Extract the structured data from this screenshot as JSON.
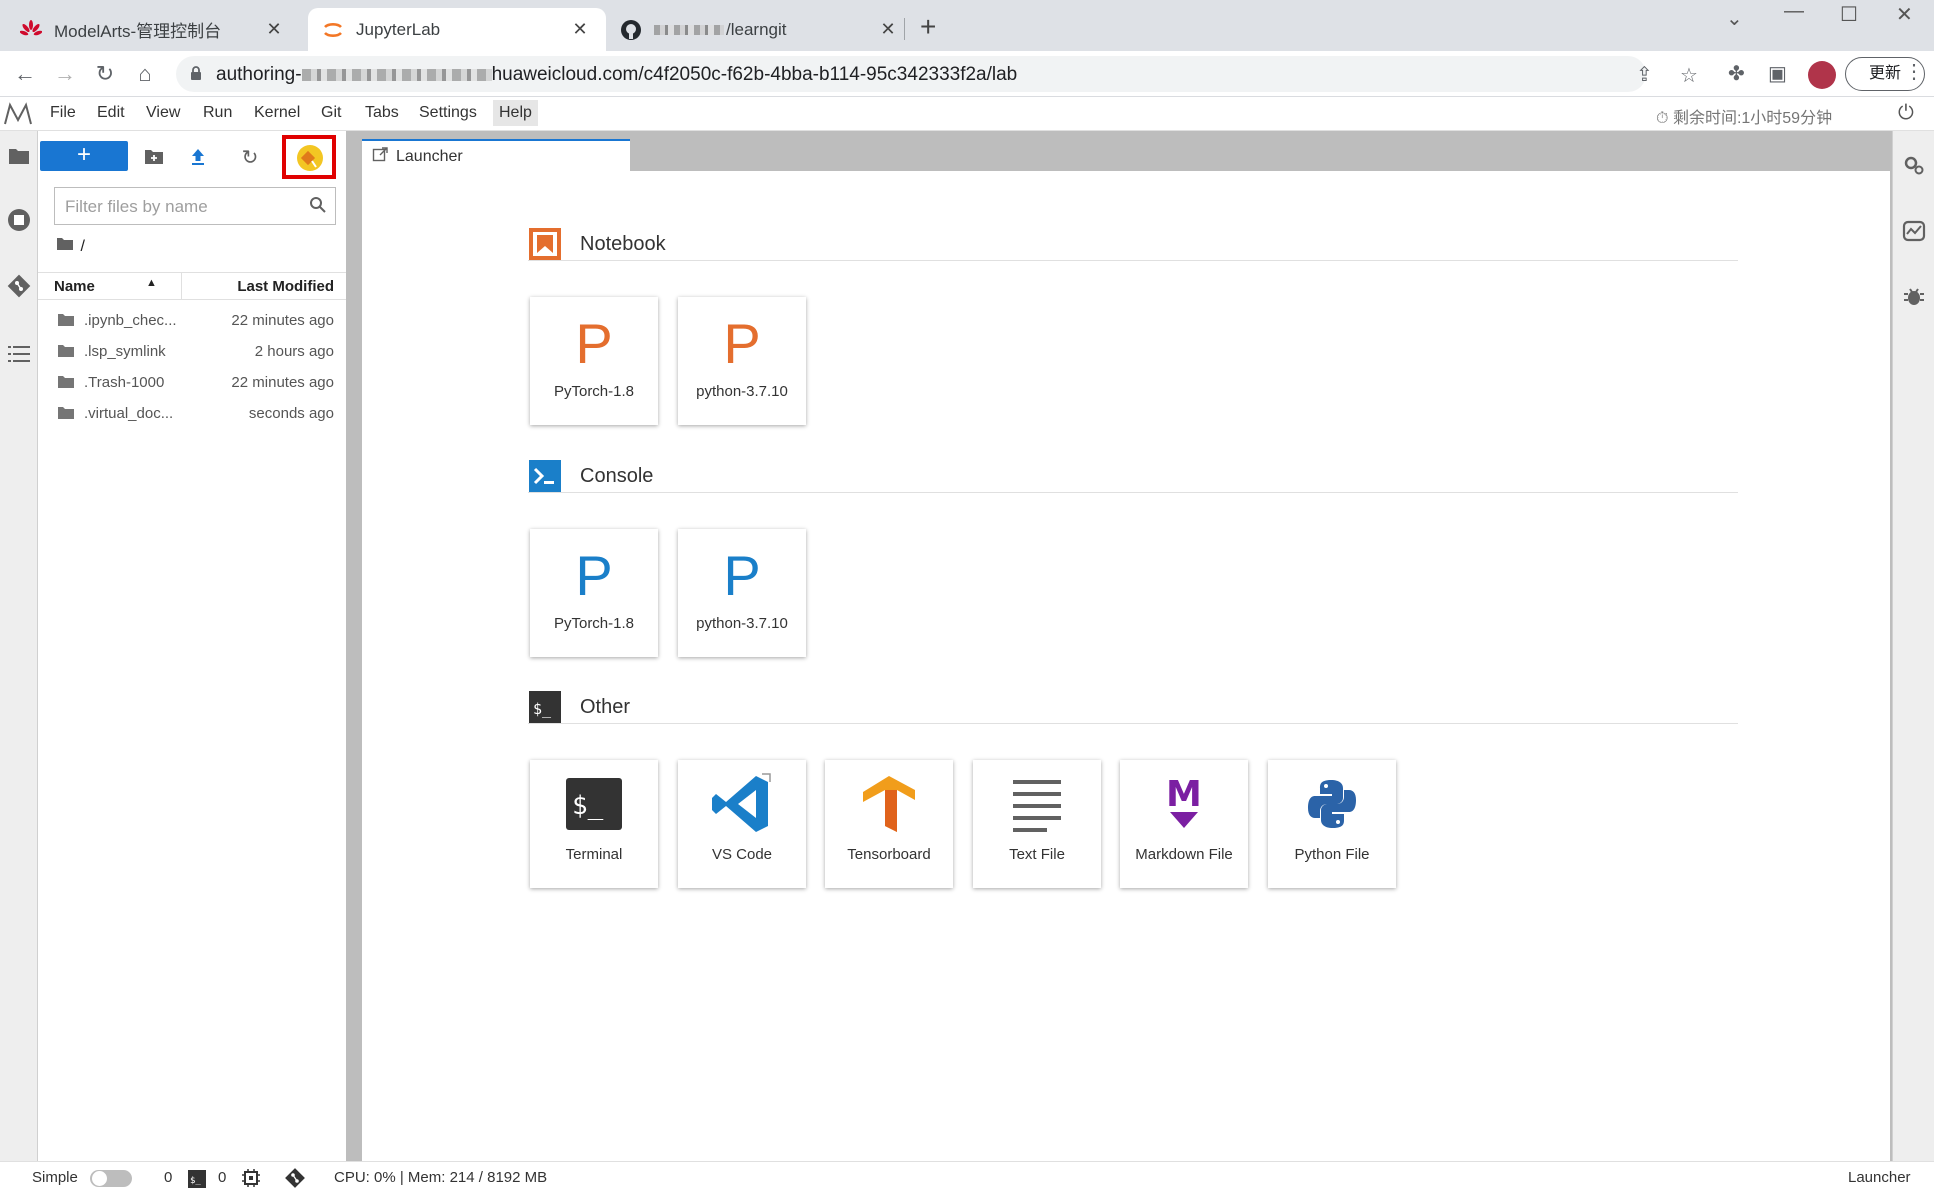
{
  "browser": {
    "tabs": [
      {
        "title": "ModelArts-管理控制台",
        "icon": "huawei-logo-icon"
      },
      {
        "title": "JupyterLab",
        "icon": "jupyter-logo-icon"
      },
      {
        "title": "/learngit",
        "icon": "github-logo-icon"
      }
    ],
    "url_prefix": "authoring-",
    "url_suffix": "huaweicloud.com/c4f2050c-f62b-4bba-b114-95c342333f2a/lab",
    "update_label": "更新"
  },
  "menubar": {
    "items": [
      "File",
      "Edit",
      "View",
      "Run",
      "Kernel",
      "Git",
      "Tabs",
      "Settings",
      "Help"
    ],
    "timer": "剩余时间:1小时59分钟"
  },
  "filebrowser": {
    "new_label": "+",
    "filter_placeholder": "Filter files by name",
    "breadcrumb": "/",
    "col_name": "Name",
    "col_modified": "Last Modified",
    "files": [
      {
        "name": ".ipynb_chec...",
        "modified": "22 minutes ago"
      },
      {
        "name": ".lsp_symlink",
        "modified": "2 hours ago"
      },
      {
        "name": ".Trash-1000",
        "modified": "22 minutes ago"
      },
      {
        "name": ".virtual_doc...",
        "modified": "seconds ago"
      }
    ]
  },
  "launcher": {
    "tab_label": "Launcher",
    "sections": {
      "notebook": {
        "title": "Notebook",
        "cards": [
          "PyTorch-1.8",
          "python-3.7.10"
        ]
      },
      "console": {
        "title": "Console",
        "cards": [
          "PyTorch-1.8",
          "python-3.7.10"
        ]
      },
      "other": {
        "title": "Other",
        "cards": [
          "Terminal",
          "VS Code",
          "Tensorboard",
          "Text File",
          "Markdown File",
          "Python File"
        ]
      }
    },
    "kernel_letter": "P"
  },
  "statusbar": {
    "mode_label": "Simple",
    "terminals": "0",
    "kernels": "0",
    "resources": "CPU: 0% | Mem: 214 / 8192 MB",
    "current": "Launcher"
  },
  "colors": {
    "accent": "#1976d2",
    "notebook": "#e46e2e",
    "console": "#1a7fc9",
    "highlight": "#e00000"
  }
}
